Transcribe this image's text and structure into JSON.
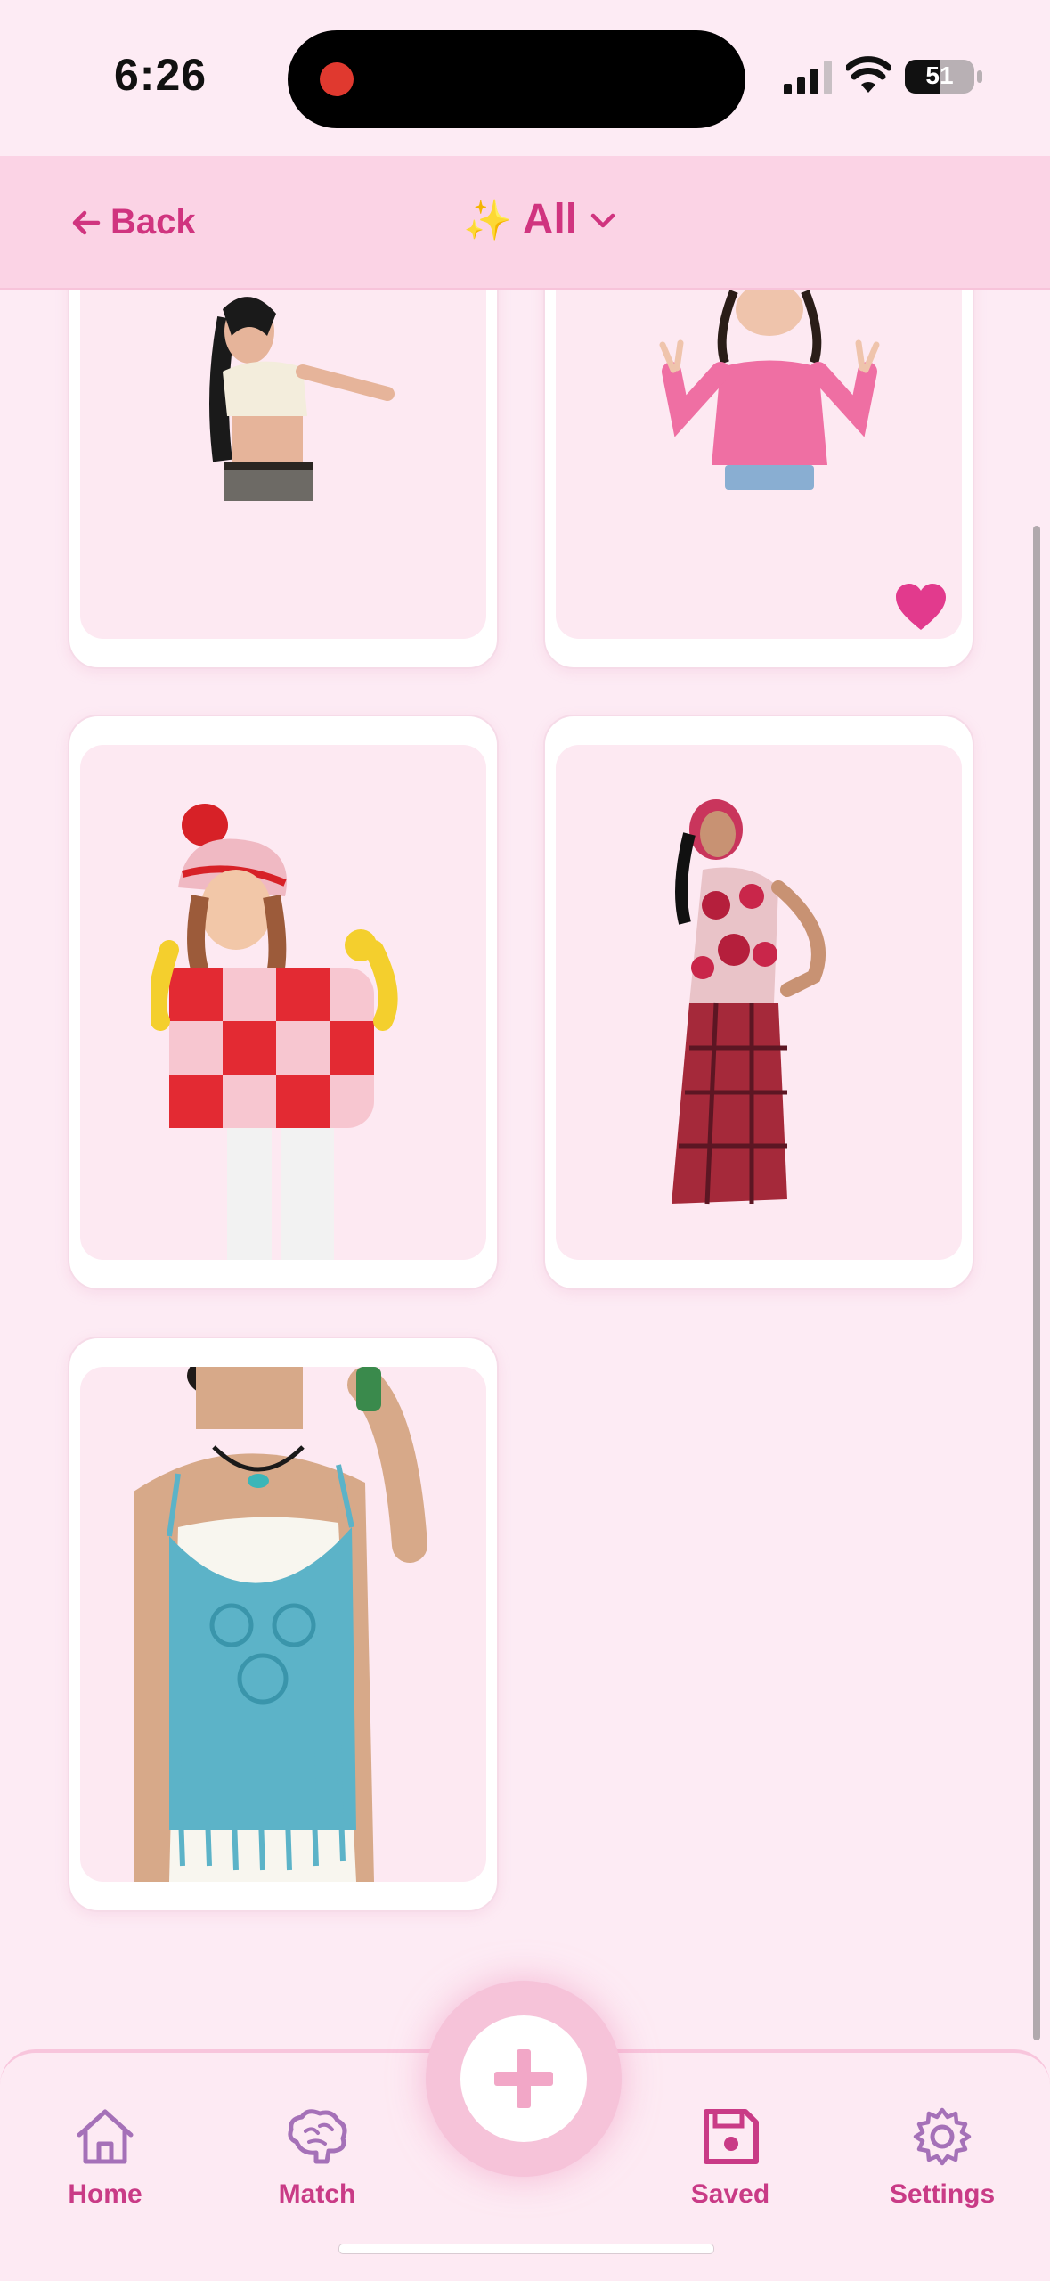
{
  "status": {
    "time": "6:26",
    "battery": "51",
    "battery_level": 0.51
  },
  "header": {
    "back_label": "Back",
    "filter_label": "All",
    "sparkle": "✨"
  },
  "items": [
    {
      "name": "white-crop-top-jeans",
      "liked": false
    },
    {
      "name": "pink-off-shoulder-top",
      "liked": true
    },
    {
      "name": "red-knit-cardigan-beanie",
      "liked": false
    },
    {
      "name": "floral-halter-plaid-skirt",
      "liked": false
    },
    {
      "name": "blue-crochet-fringe-top",
      "liked": false
    }
  ],
  "tabs": {
    "home": "Home",
    "match": "Match",
    "saved": "Saved",
    "settings": "Settings"
  },
  "colors": {
    "accent": "#d0347f",
    "header_bg": "#fbd3e5",
    "page_bg": "#fdebf4",
    "heart": "#e23a8d"
  },
  "icons": [
    "back-arrow-icon",
    "chevron-down-icon",
    "heart-icon",
    "home-icon",
    "brain-icon",
    "floppy-disk-icon",
    "gear-icon",
    "plus-icon"
  ]
}
